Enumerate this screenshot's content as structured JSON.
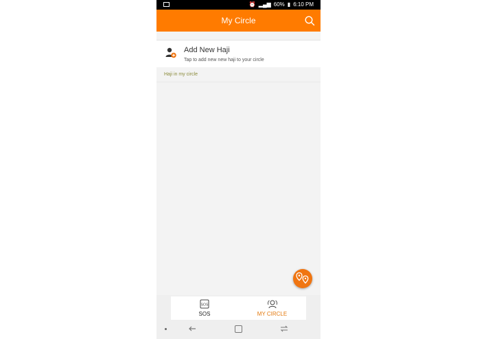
{
  "status_bar": {
    "battery": "60%",
    "time": "6:10 PM"
  },
  "header": {
    "title": "My Circle"
  },
  "add_new": {
    "title": "Add New Haji",
    "subtitle": "Tap to add new new haji to your circle"
  },
  "section": {
    "label": "Haji in my circle"
  },
  "bottom_nav": {
    "items": [
      {
        "label": "SOS",
        "icon": "sos-icon"
      },
      {
        "label": "MY CIRCLE",
        "icon": "circle-icon",
        "active": true
      }
    ]
  },
  "colors": {
    "brand": "#ff7b00",
    "active_nav": "#e3780c",
    "section_label": "#8a8a3a"
  }
}
